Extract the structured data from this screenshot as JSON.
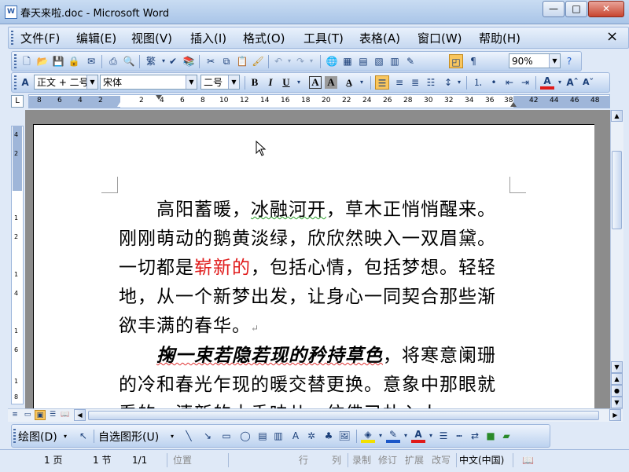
{
  "window": {
    "title": "春天来啦.doc - Microsoft Word",
    "app_icon": "W"
  },
  "window_buttons": {
    "minimize": "—",
    "maximize": "□",
    "close": "✕"
  },
  "menu": {
    "items": [
      "文件(F)",
      "编辑(E)",
      "视图(V)",
      "插入(I)",
      "格式(O)",
      "工具(T)",
      "表格(A)",
      "窗口(W)",
      "帮助(H)"
    ],
    "close_doc": "×"
  },
  "standard_toolbar": {
    "zoom": "90%"
  },
  "formatting_toolbar": {
    "style": "正文 + 二号",
    "font": "宋体",
    "size": "二号"
  },
  "ruler": {
    "labels": [
      "8",
      "6",
      "4",
      "2",
      "2",
      "4",
      "6",
      "8",
      "10",
      "12",
      "14",
      "16",
      "18",
      "20",
      "22",
      "24",
      "26",
      "28",
      "30",
      "32",
      "34",
      "36",
      "38",
      "42",
      "44",
      "46",
      "48"
    ],
    "vlabels": [
      "4",
      "2",
      "1",
      "2",
      "1",
      "4",
      "1",
      "6",
      "1",
      "8"
    ]
  },
  "document": {
    "para1": {
      "indent": "　　",
      "seg1": "高阳蓄暖，",
      "seg2": "冰融河开",
      "seg3": "，草木正悄悄醒来。刚刚萌动的鹅黄淡绿，欣欣然映入一双眉黛。一切都是",
      "red": "崭新的",
      "seg4": "，包括心情，包括梦想。轻轻地，从一个新梦出发，让身心一同契合那些渐欲丰满的春华。",
      "mark": "↵"
    },
    "para2": {
      "indent": "　　",
      "bold_italic": "掬一束若隐若现的矜持草色",
      "rest": "，将寒意阑珊的冷和春光乍现的暖交替更换。意象中那眼就看的，清新的土香味儿，仿佛已扑入人"
    }
  },
  "drawing_toolbar": {
    "draw": "绘图(D)",
    "autoshapes": "自选图形(U)"
  },
  "status_bar": {
    "page": "1 页",
    "section": "1 节",
    "page_of": "1/1",
    "position": "位置",
    "line": "行",
    "column": "列",
    "rec": "录制",
    "trk": "修订",
    "ext": "扩展",
    "ovr": "改写",
    "language": "中文(中国)"
  },
  "colors": {
    "red_text": "#e01a1a",
    "font_color": "#e01a1a",
    "highlight": "#f2e000",
    "line_color": "#1a56c8",
    "active_button": "#f9c65e"
  }
}
